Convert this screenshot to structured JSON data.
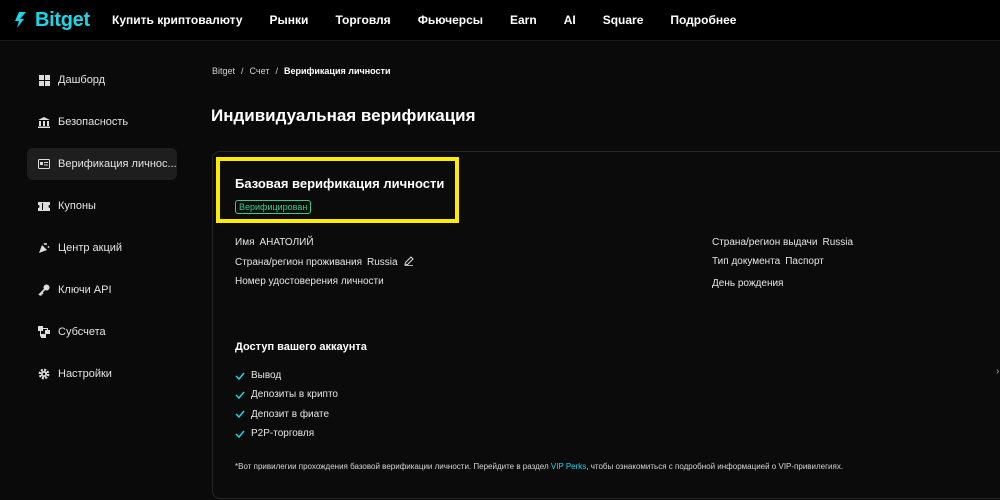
{
  "brand": {
    "name": "Bitget",
    "color": "#1dd5e6"
  },
  "nav": {
    "items": [
      {
        "label": "Купить криптовалюту"
      },
      {
        "label": "Рынки"
      },
      {
        "label": "Торговля"
      },
      {
        "label": "Фьючерсы"
      },
      {
        "label": "Earn"
      },
      {
        "label": "AI"
      },
      {
        "label": "Square"
      },
      {
        "label": "Подробнее"
      }
    ]
  },
  "sidebar": {
    "items": [
      {
        "label": "Дашборд",
        "icon": "dashboard-icon"
      },
      {
        "label": "Безопасность",
        "icon": "bank-icon"
      },
      {
        "label": "Верификация личнос...",
        "icon": "id-card-icon",
        "active": true
      },
      {
        "label": "Купоны",
        "icon": "coupon-icon"
      },
      {
        "label": "Центр акций",
        "icon": "party-icon"
      },
      {
        "label": "Ключи API",
        "icon": "key-icon"
      },
      {
        "label": "Субсчета",
        "icon": "subaccount-icon"
      },
      {
        "label": "Настройки",
        "icon": "gear-icon"
      }
    ]
  },
  "breadcrumb": {
    "root": "Bitget",
    "sep1": "/",
    "account": "Счет",
    "sep2": "/",
    "current": "Верификация личности"
  },
  "page": {
    "title": "Индивидуальная верификация"
  },
  "card": {
    "title": "Базовая верификация личности",
    "badge": "Верифицирован",
    "badge_color": "#2ecf8f",
    "highlight_color": "#ffeb00",
    "left": {
      "name_label": "Имя",
      "name_value": "АНАТОЛИЙ",
      "residence_label": "Страна/регион проживания",
      "residence_value": "Russia",
      "id_label": "Номер удостоверения личности"
    },
    "right": {
      "issue_label": "Страна/регион выдачи",
      "issue_value": "Russia",
      "doc_label": "Тип документа",
      "doc_value": "Паспорт",
      "birthday_label": "День рождения"
    },
    "access_title": "Доступ вашего аккаунта",
    "access_items": [
      {
        "label": "Вывод"
      },
      {
        "label": "Депозиты в крипто"
      },
      {
        "label": "Депозит в фиате"
      },
      {
        "label": "P2P-торговля"
      }
    ],
    "footnote": {
      "before": "*Вот привилегии прохождения базовой верификации личности. Перейдите в раздел",
      "link": "VIP Perks",
      "after": ", чтобы ознакомиться с подробной информацией о VIP-привилегиях."
    },
    "check_color": "#1dd5e6"
  }
}
